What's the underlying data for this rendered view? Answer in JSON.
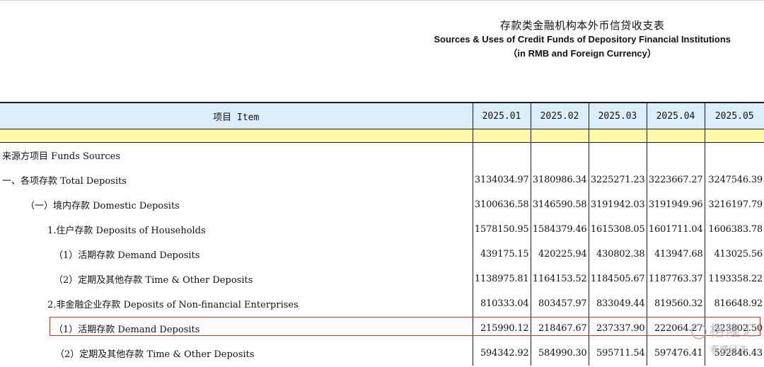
{
  "title": {
    "cn": "存款类金融机构本外币信贷收支表",
    "en": "Sources & Uses of Credit Funds of Depository Financial Institutions",
    "sub": "（in RMB and Foreign Currency）"
  },
  "table": {
    "header_item": "项目 Item",
    "periods": [
      "2025.01",
      "2025.02",
      "2025.03",
      "2025.04",
      "2025.05"
    ],
    "rows": [
      {
        "label": "来源方项目  Funds Sources",
        "values": [
          "",
          "",
          "",
          "",
          ""
        ]
      },
      {
        "label": "一、各项存款  Total Deposits",
        "values": [
          "3134034.97",
          "3180986.34",
          "3225271.23",
          "3223667.27",
          "3247546.39"
        ]
      },
      {
        "label": "（一）境内存款 Domestic Deposits",
        "values": [
          "3100636.58",
          "3146590.58",
          "3191942.03",
          "3191949.96",
          "3216197.79"
        ]
      },
      {
        "label": "1.住户存款 Deposits of Households",
        "values": [
          "1578150.95",
          "1584379.46",
          "1615308.05",
          "1601711.04",
          "1606383.78"
        ]
      },
      {
        "label": "（1）活期存款 Demand  Deposits",
        "values": [
          "439175.15",
          "420225.94",
          "430802.38",
          "413947.68",
          "413025.56"
        ]
      },
      {
        "label": "（2）定期及其他存款   Time & Other Deposits",
        "values": [
          "1138975.81",
          "1164153.52",
          "1184505.67",
          "1187763.37",
          "1193358.22"
        ]
      },
      {
        "label": "2.非金融企业存款 Deposits of Non-financial Enterprises",
        "values": [
          "810333.04",
          "803457.97",
          "833049.44",
          "819560.32",
          "816648.92"
        ]
      },
      {
        "label": "（1）活期存款 Demand  Deposits",
        "values": [
          "215990.12",
          "218467.67",
          "237337.90",
          "222064.27",
          "223802.50"
        ]
      },
      {
        "label": "（2）定期及其他存款 Time  & Other Deposits",
        "values": [
          "594342.92",
          "584990.30",
          "595711.54",
          "597476.41",
          "592846.43"
        ]
      }
    ]
  },
  "watermark": {
    "text": "格隆汇",
    "sub": "看懂经济"
  }
}
